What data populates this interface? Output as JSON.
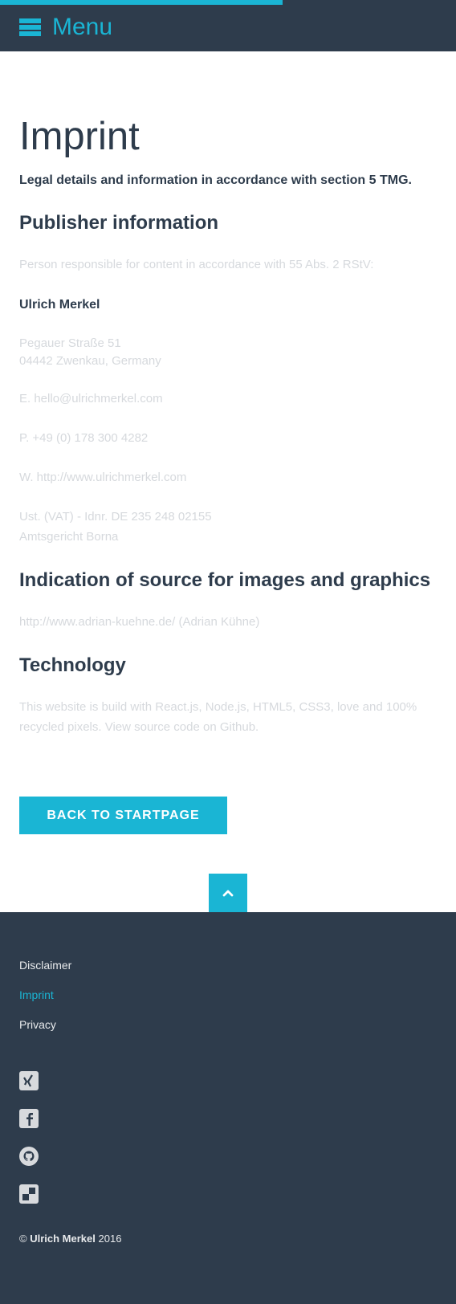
{
  "header": {
    "menu_label": "Menu",
    "progress_fraction": 0.62,
    "accent_color": "#1ab5d4",
    "background_color": "#2e3c4c",
    "menu_icon": "hamburger-icon"
  },
  "content": {
    "title": "Imprint",
    "lead": "Legal details and information in accordance with section 5 TMG.",
    "publisher_heading": "Publisher information",
    "responsible_note": "Person responsible for content in accordance with 55 Abs. 2 RStV:",
    "name": "Ulrich Merkel",
    "address_line1": "Pegauer Straße 51",
    "address_line2": "04442 Zwenkau, Germany",
    "email": "E. hello@ulrichmerkel.com",
    "phone": "P. +49 (0) 178 300 4282",
    "web": "W. http://www.ulrichmerkel.com",
    "vat": "Ust. (VAT) - Idnr. DE 235 248 02155",
    "court": "Amtsgericht Borna",
    "images_heading": "Indication of source for images and graphics",
    "images_source": "http://www.adrian-kuehne.de/ (Adrian Kühne)",
    "technology_heading": "Technology",
    "technology_line1": "This website is build with React.js, Node.js, HTML5, CSS3, love and 100%",
    "technology_line2": "recycled pixels. View source code on Github.",
    "back_button": "BACK TO STARTPAGE",
    "scroll_top_icon": "chevron-up-icon"
  },
  "footer": {
    "links": [
      {
        "label": "Disclaimer",
        "active": false
      },
      {
        "label": "Imprint",
        "active": true
      },
      {
        "label": "Privacy",
        "active": false
      }
    ],
    "social_icons": [
      "xing-icon",
      "facebook-icon",
      "github-icon",
      "delicious-icon"
    ],
    "copyright_symbol": "©",
    "copyright_name": "Ulrich Merkel",
    "copyright_year": "2016"
  }
}
